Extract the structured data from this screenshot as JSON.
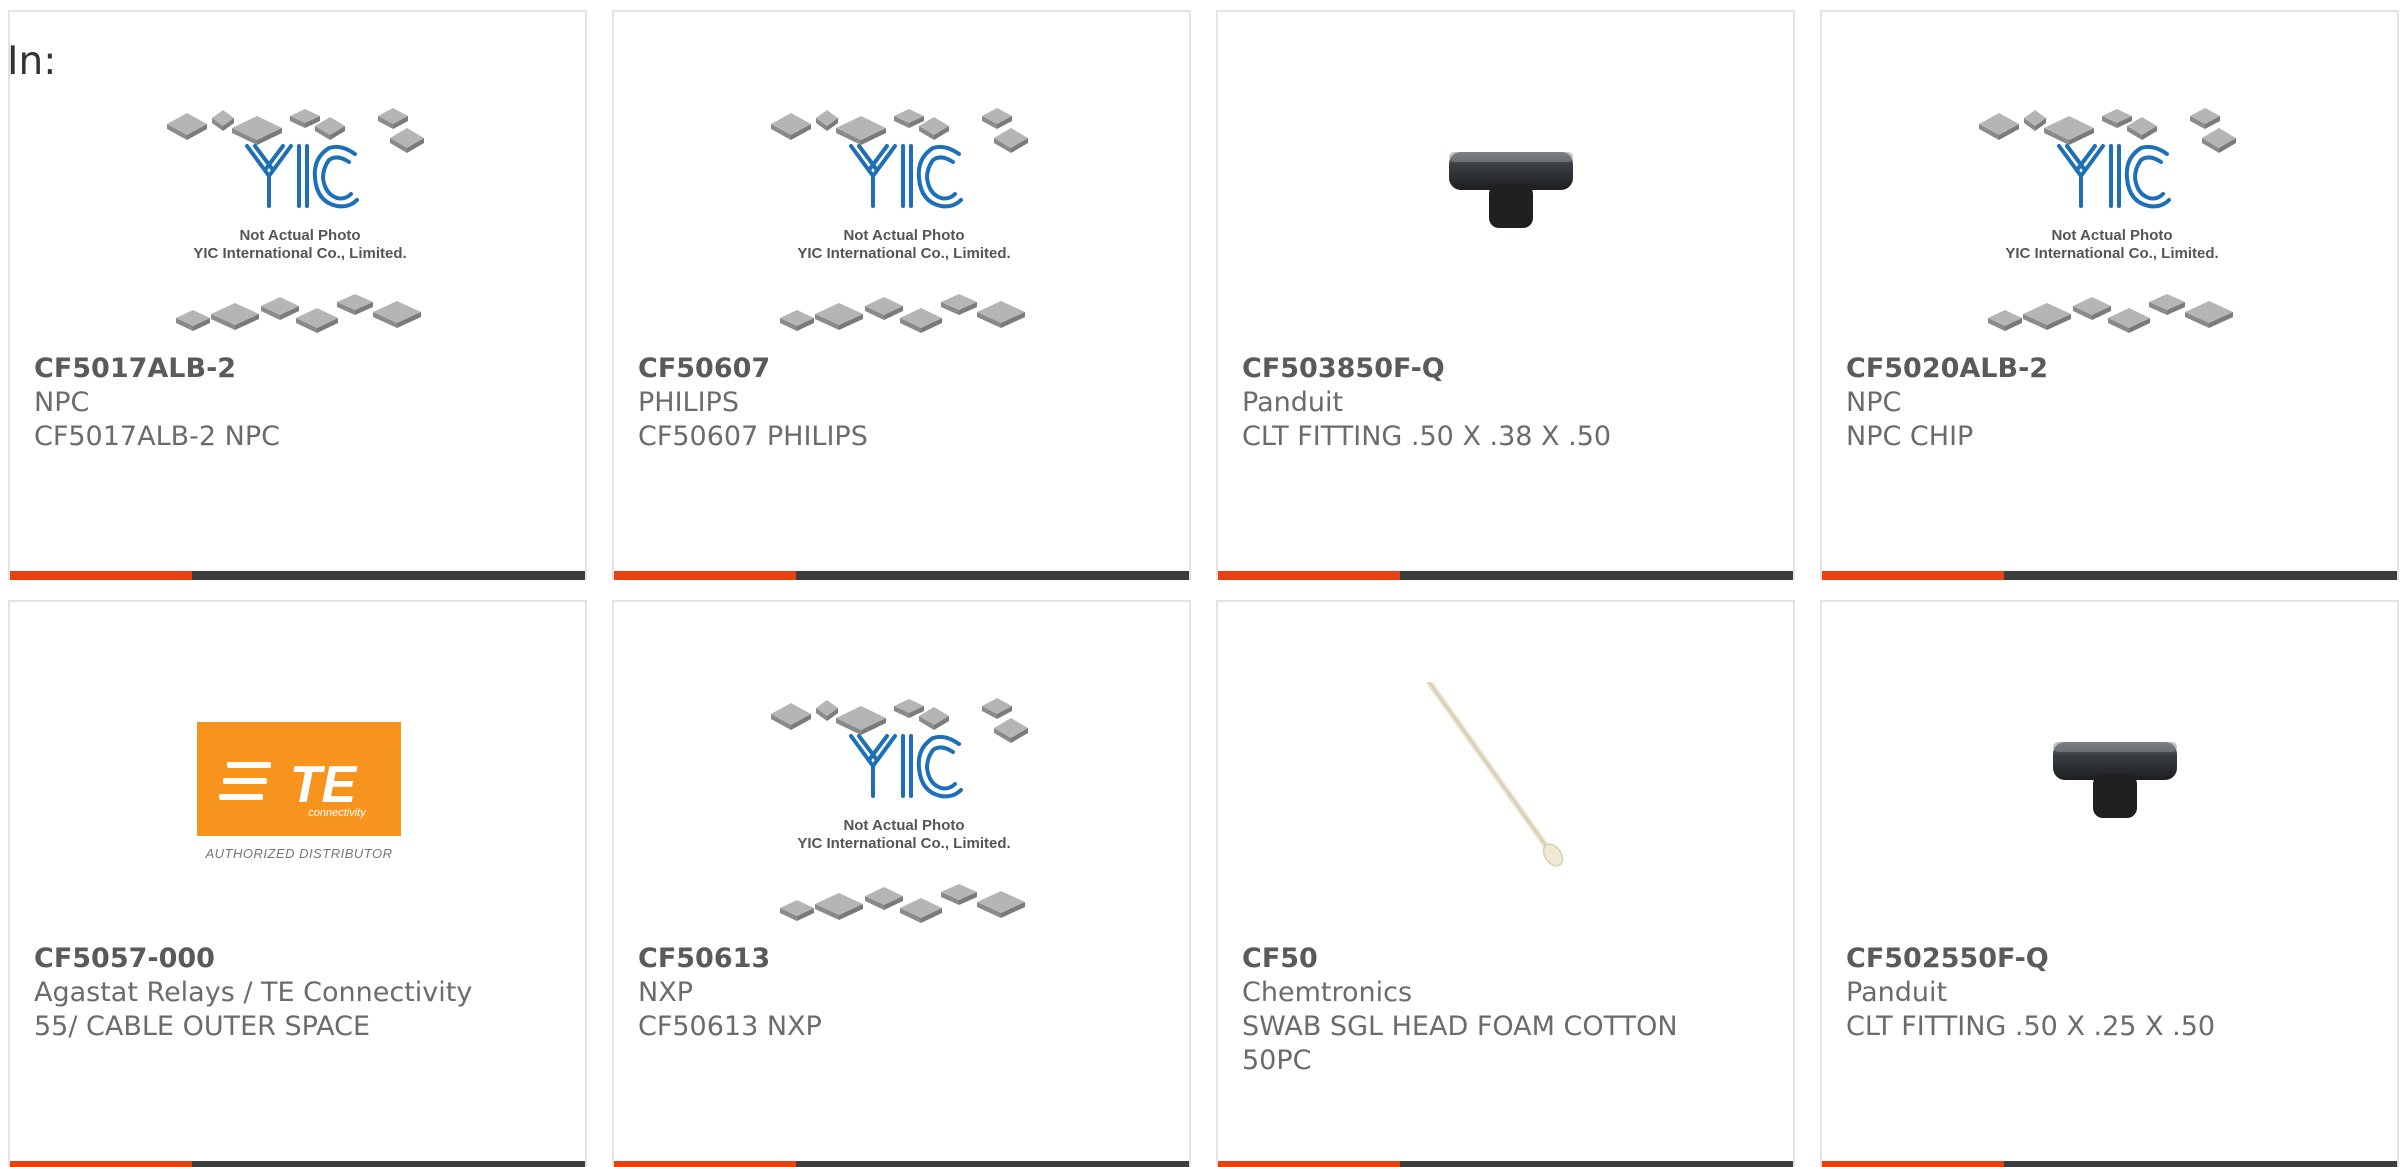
{
  "filter": {
    "label": "In:"
  },
  "products": [
    {
      "part_number": "CF5017ALB-2",
      "manufacturer": "NPC",
      "description": "CF5017ALB-2 NPC",
      "image": "yic-placeholder",
      "image_caption_1": "Not Actual Photo",
      "image_caption_2": "YIC International Co., Limited."
    },
    {
      "part_number": "CF50607",
      "manufacturer": "PHILIPS",
      "description": "CF50607 PHILIPS",
      "image": "yic-placeholder",
      "image_caption_1": "Not Actual Photo",
      "image_caption_2": "YIC International Co., Limited."
    },
    {
      "part_number": "CF503850F-Q",
      "manufacturer": "Panduit",
      "description": "CLT FITTING .50 X .38 X .50",
      "image": "t-fitting"
    },
    {
      "part_number": "CF5020ALB-2",
      "manufacturer": "NPC",
      "description": "NPC CHIP",
      "image": "yic-placeholder",
      "image_caption_1": "Not Actual Photo",
      "image_caption_2": "YIC International Co., Limited."
    },
    {
      "part_number": "CF5057-000",
      "manufacturer": "Agastat Relays / TE Connectivity",
      "description": "55/ CABLE OUTER SPACE",
      "image": "te-logo",
      "image_logo_text": "TE",
      "image_logo_sub": "connectivity",
      "image_caption_1": "AUTHORIZED DISTRIBUTOR"
    },
    {
      "part_number": "CF50613",
      "manufacturer": "NXP",
      "description": "CF50613 NXP",
      "image": "yic-placeholder",
      "image_caption_1": "Not Actual Photo",
      "image_caption_2": "YIC International Co., Limited."
    },
    {
      "part_number": "CF50",
      "manufacturer": "Chemtronics",
      "description": "SWAB SGL HEAD FOAM COTTON 50PC",
      "image": "swab"
    },
    {
      "part_number": "CF502550F-Q",
      "manufacturer": "Panduit",
      "description": "CLT FITTING .50 X .25 X .50",
      "image": "t-fitting"
    }
  ],
  "colors": {
    "accent": "#e84112",
    "bar": "#3d3d3d",
    "te_orange": "#f7941d",
    "yic_blue": "#1d6fb8"
  }
}
